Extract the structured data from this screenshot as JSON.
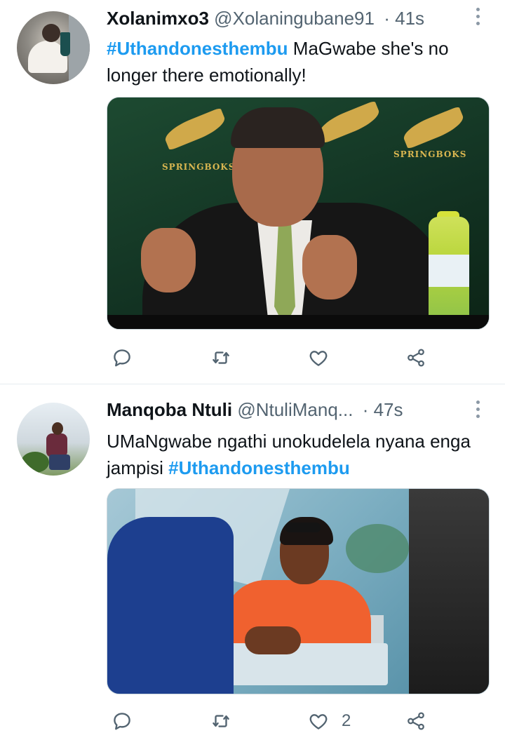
{
  "tweets": [
    {
      "display_name": "Xolanimxo3",
      "handle": "@Xolaningubane91",
      "separator": "·",
      "time": "41s",
      "text_parts": [
        {
          "type": "hashtag",
          "text": "#Uthandonesthembu"
        },
        {
          "type": "text",
          "text": " MaGwabe  she's no longer there emotionally!"
        }
      ],
      "media_logo_text": "SPRINGBOKS",
      "actions": {
        "reply_icon": "reply-icon",
        "retweet_icon": "retweet-icon",
        "like_icon": "heart-icon",
        "share_icon": "share-icon",
        "like_count": ""
      }
    },
    {
      "display_name": "Manqoba Ntuli",
      "handle": "@NtuliManq...",
      "separator": "·",
      "time": "47s",
      "text_parts": [
        {
          "type": "text",
          "text": "UMaNgwabe ngathi unokudelela nyana enga jampisi "
        },
        {
          "type": "hashtag",
          "text": "#Uthandonesthembu"
        }
      ],
      "actions": {
        "reply_icon": "reply-icon",
        "retweet_icon": "retweet-icon",
        "like_icon": "heart-icon",
        "share_icon": "share-icon",
        "like_count": "2"
      }
    }
  ],
  "colors": {
    "accent": "#1d9bf0",
    "secondary_text": "#536471",
    "icon": "#536471"
  }
}
